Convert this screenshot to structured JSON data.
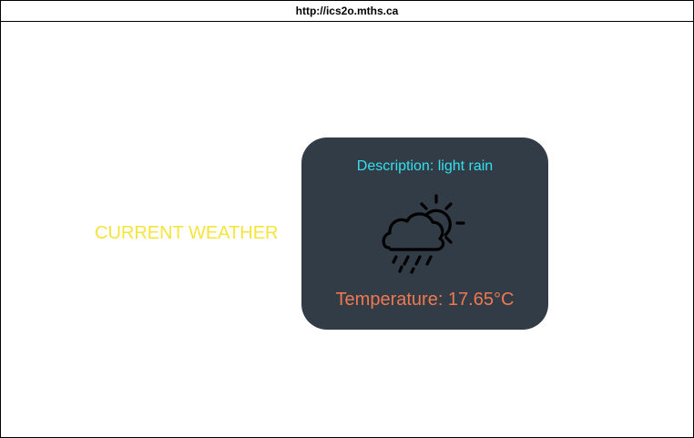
{
  "browser": {
    "url": "http://ics2o.mths.ca"
  },
  "page": {
    "heading": "CURRENT WEATHER"
  },
  "weather_card": {
    "description": "Description: light rain",
    "temperature": "Temperature: 17.65°C",
    "icon": "cloud-sun-rain-icon"
  },
  "colors": {
    "heading": "#f5e43a",
    "card_background": "#323c46",
    "description": "#33e0f0",
    "temperature": "#ef7850"
  }
}
